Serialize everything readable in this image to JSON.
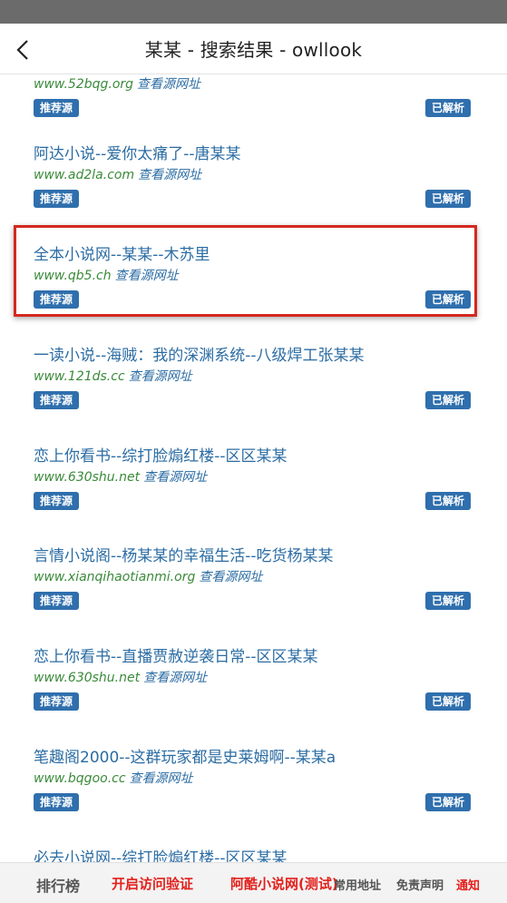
{
  "header": {
    "title": "某某 - 搜索结果 - owllook"
  },
  "badges": {
    "recommend": "推荐源",
    "parsed": "已解析"
  },
  "view_source_label": "查看源网址",
  "partial_top_url": "www.52bqg.org",
  "results": [
    {
      "title": "阿达小说--爱你太痛了--唐某某",
      "url": "www.ad2la.com"
    },
    {
      "title": "全本小说网--某某--木苏里",
      "url": "www.qb5.ch"
    },
    {
      "title": "一读小说--海贼：我的深渊系统--八级焊工张某某",
      "url": "www.121ds.cc"
    },
    {
      "title": "恋上你看书--综打脸煽红楼--区区某某",
      "url": "www.630shu.net"
    },
    {
      "title": "言情小说阁--杨某某的幸福生活--吃货杨某某",
      "url": "www.xianqihaotianmi.org"
    },
    {
      "title": "恋上你看书--直播贾赦逆袭日常--区区某某",
      "url": "www.630shu.net"
    },
    {
      "title": "笔趣阁2000--这群玩家都是史莱姆啊--某某a",
      "url": "www.bqgoo.cc"
    }
  ],
  "partial_bottom_title": "必去小说网--综打脸煽红楼--区区某某",
  "bottom_nav": {
    "rank": "排行榜",
    "verify": "开启访问验证",
    "akoo": "阿酷小说网(测试)",
    "addr": "常用地址",
    "disclaimer": "免责声明",
    "notice": "通知"
  }
}
